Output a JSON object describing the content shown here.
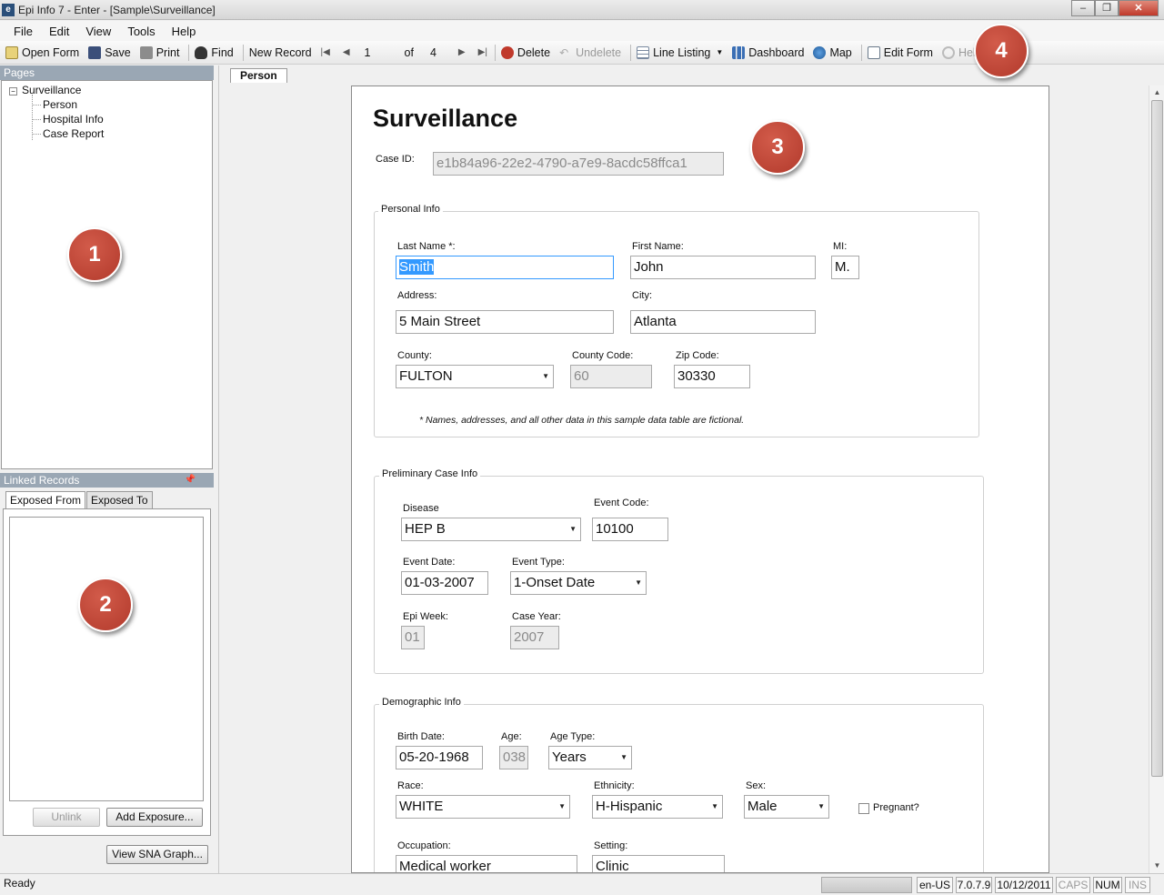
{
  "window": {
    "title": "Epi Info 7 - Enter - [Sample\\Surveillance]",
    "minimize": "–",
    "restore": "❐",
    "close": "✕"
  },
  "menu": [
    "File",
    "Edit",
    "View",
    "Tools",
    "Help"
  ],
  "toolbar": {
    "open_form": "Open Form",
    "save": "Save",
    "print": "Print",
    "find": "Find",
    "new_record": "New Record",
    "record_current": "1",
    "record_of": "of",
    "record_total": "4",
    "delete": "Delete",
    "undelete": "Undelete",
    "line_listing": "Line Listing",
    "dashboard": "Dashboard",
    "map": "Map",
    "edit_form": "Edit Form",
    "help": "Help"
  },
  "pages_panel": {
    "header": "Pages",
    "root": "Surveillance",
    "root_toggle": "−",
    "items": [
      "Person",
      "Hospital Info",
      "Case Report"
    ]
  },
  "linked_records": {
    "header": "Linked Records",
    "pin": "📌",
    "tabs": [
      "Exposed From",
      "Exposed To"
    ],
    "unlink": "Unlink",
    "add_exposure": "Add Exposure...",
    "view_sna": "View SNA Graph..."
  },
  "page_tab": "Person",
  "form": {
    "title": "Surveillance",
    "case_id_label": "Case ID:",
    "case_id_value": "e1b84a96-22e2-4790-a7e9-8acdc58ffca1",
    "personal_info": {
      "group": "Personal Info",
      "last_name_label": "Last Name *:",
      "last_name": "Smith",
      "first_name_label": "First Name:",
      "first_name": "John",
      "mi_label": "MI:",
      "mi": "M.",
      "address_label": "Address:",
      "address": "5 Main Street",
      "city_label": "City:",
      "city": "Atlanta",
      "county_label": "County:",
      "county": "FULTON",
      "county_code_label": "County Code:",
      "county_code": "60",
      "zip_label": "Zip Code:",
      "zip": "30330",
      "note": "* Names, addresses, and all other data in this sample data table are fictional."
    },
    "preliminary": {
      "group": "Preliminary Case Info",
      "disease_label": "Disease",
      "disease": "HEP B",
      "event_code_label": "Event Code:",
      "event_code": "10100",
      "event_date_label": "Event Date:",
      "event_date": "01-03-2007",
      "event_type_label": "Event Type:",
      "event_type": "1-Onset Date",
      "epi_week_label": "Epi Week:",
      "epi_week": "01",
      "case_year_label": "Case Year:",
      "case_year": "2007"
    },
    "demographic": {
      "group": "Demographic Info",
      "birth_date_label": "Birth Date:",
      "birth_date": "05-20-1968",
      "age_label": "Age:",
      "age": "038",
      "age_type_label": "Age Type:",
      "age_type": "Years",
      "race_label": "Race:",
      "race": "WHITE",
      "ethnicity_label": "Ethnicity:",
      "ethnicity": "H-Hispanic",
      "sex_label": "Sex:",
      "sex": "Male",
      "pregnant_label": "Pregnant?",
      "occupation_label": "Occupation:",
      "occupation": "Medical worker",
      "setting_label": "Setting:",
      "setting": "Clinic"
    }
  },
  "callouts": [
    "1",
    "2",
    "3",
    "4"
  ],
  "status": {
    "ready": "Ready",
    "locale": "en-US",
    "version": "7.0.7.9",
    "date": "10/12/2011",
    "caps": "CAPS",
    "num": "NUM",
    "ins": "INS"
  },
  "colors": {
    "callout": "#c0392b",
    "panel_header": "#9aa7b4",
    "selection": "#3399ff"
  }
}
